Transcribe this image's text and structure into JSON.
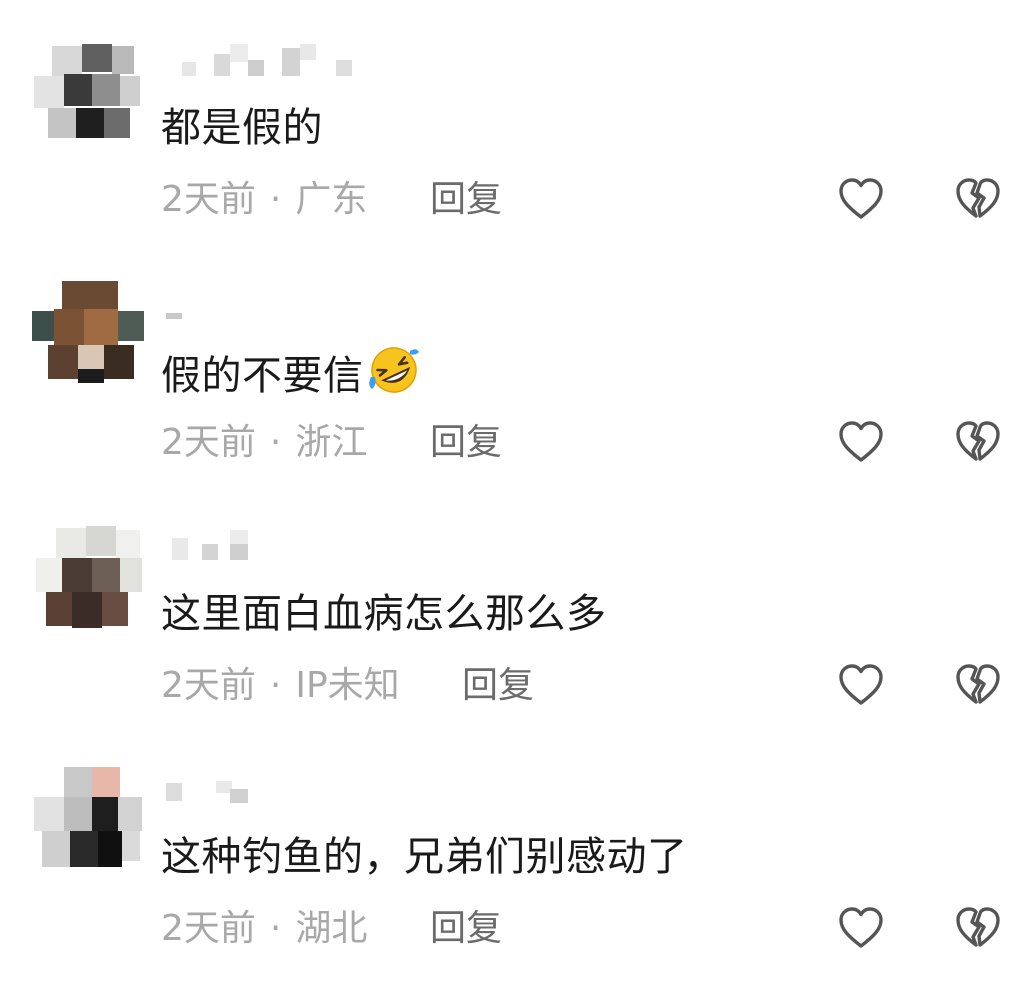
{
  "comments": [
    {
      "username": "",
      "content": "都是假的",
      "time": "2天前",
      "separator": "·",
      "location": "广东",
      "reply_label": "回复",
      "emoji": ""
    },
    {
      "username": "",
      "content": "假的不要信",
      "time": "2天前",
      "separator": "·",
      "location": "浙江",
      "reply_label": "回复",
      "emoji": "rolling-on-floor-laughing-emoji"
    },
    {
      "username": "",
      "content": "这里面白血病怎么那么多",
      "time": "2天前",
      "separator": "·",
      "location": "IP未知",
      "reply_label": "回复",
      "emoji": ""
    },
    {
      "username": "",
      "content": "这种钓鱼的，兄弟们别感动了",
      "time": "2天前",
      "separator": "·",
      "location": "湖北",
      "reply_label": "回复",
      "emoji": ""
    }
  ],
  "icons": {
    "like": "heart-outline-icon",
    "dislike": "broken-heart-icon"
  },
  "colors": {
    "text_primary": "#1a1a1a",
    "text_meta": "#a8a8a8",
    "reply": "#6b6b6b",
    "icon": "#555555",
    "emoji_yellow": "#f7c31f",
    "emoji_tear": "#3b9df5"
  }
}
